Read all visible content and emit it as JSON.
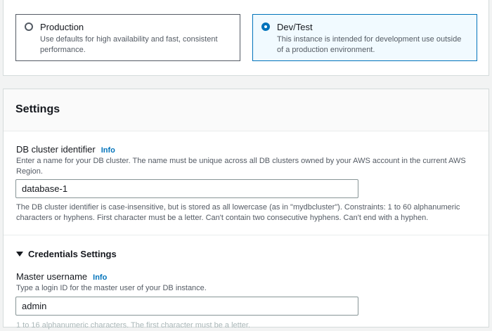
{
  "template_options": {
    "production": {
      "title": "Production",
      "description": "Use defaults for high availability and fast, consistent performance.",
      "selected": false
    },
    "devtest": {
      "title": "Dev/Test",
      "description": "This instance is intended for development use outside of a production environment.",
      "selected": true
    }
  },
  "settings": {
    "title": "Settings",
    "cluster_identifier": {
      "label": "DB cluster identifier",
      "info": "Info",
      "description": "Enter a name for your DB cluster. The name must be unique across all DB clusters owned by your AWS account in the current AWS Region.",
      "value": "database-1",
      "constraint": "The DB cluster identifier is case-insensitive, but is stored as all lowercase (as in \"mydbcluster\"). Constraints: 1 to 60 alphanumeric characters or hyphens. First character must be a letter. Can't contain two consecutive hyphens. Can't end with a hyphen."
    },
    "credentials": {
      "toggle_label": "Credentials Settings",
      "master_username": {
        "label": "Master username",
        "info": "Info",
        "description": "Type a login ID for the master user of your DB instance.",
        "value": "admin",
        "constraint_partial": "1 to 16 alphanumeric characters. The first character must be a letter."
      }
    }
  },
  "colors": {
    "accent": "#0073bb",
    "selected_bg": "#f1faff",
    "border": "#d5dbdb"
  }
}
